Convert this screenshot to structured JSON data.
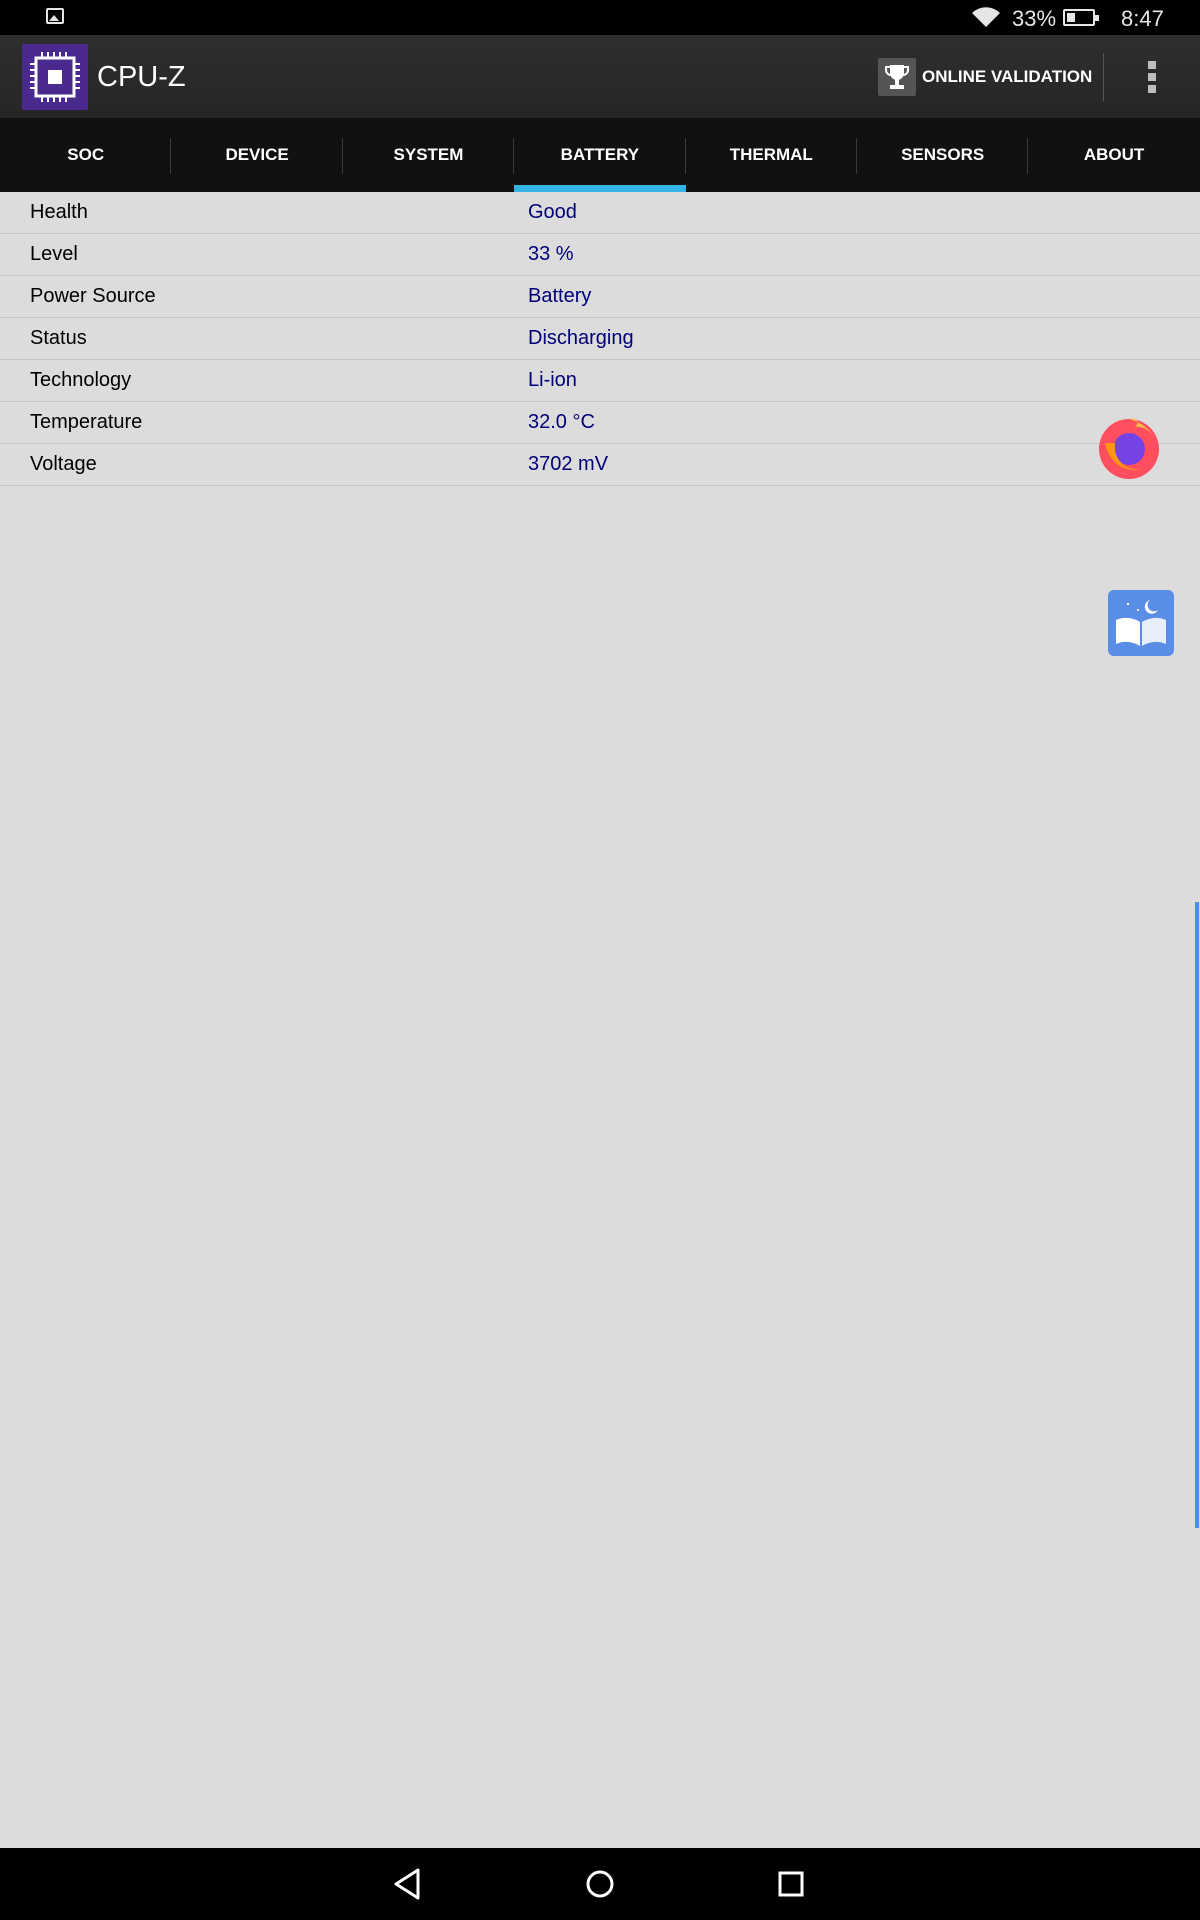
{
  "status_bar": {
    "battery_percent": "33%",
    "battery_level": 0.33,
    "time": "8:47",
    "icons": [
      "image-notification-icon",
      "wifi-icon",
      "battery-icon"
    ]
  },
  "app_bar": {
    "title": "CPU-Z",
    "validation_label": "ONLINE VALIDATION",
    "icons": [
      "cpu-z-logo-icon",
      "trophy-icon",
      "overflow-menu-icon"
    ]
  },
  "tabs": [
    {
      "label": "SOC",
      "active": false
    },
    {
      "label": "DEVICE",
      "active": false
    },
    {
      "label": "SYSTEM",
      "active": false
    },
    {
      "label": "BATTERY",
      "active": true
    },
    {
      "label": "THERMAL",
      "active": false
    },
    {
      "label": "SENSORS",
      "active": false
    },
    {
      "label": "ABOUT",
      "active": false
    }
  ],
  "battery_info": [
    {
      "label": "Health",
      "value": "Good"
    },
    {
      "label": "Level",
      "value": "33 %"
    },
    {
      "label": "Power Source",
      "value": "Battery"
    },
    {
      "label": "Status",
      "value": "Discharging"
    },
    {
      "label": "Technology",
      "value": "Li-ion"
    },
    {
      "label": "Temperature",
      "value": "32.0 °C"
    },
    {
      "label": "Voltage",
      "value": "3702 mV"
    }
  ],
  "floating": [
    "firefox-icon",
    "reader-book-icon"
  ],
  "nav_bar": [
    "back-icon",
    "home-icon",
    "recents-icon"
  ],
  "colors": {
    "tab_indicator": "#33b5e5",
    "value_text": "#00007a",
    "background": "#dcdcdc",
    "logo_bg": "#4b2a8f"
  }
}
